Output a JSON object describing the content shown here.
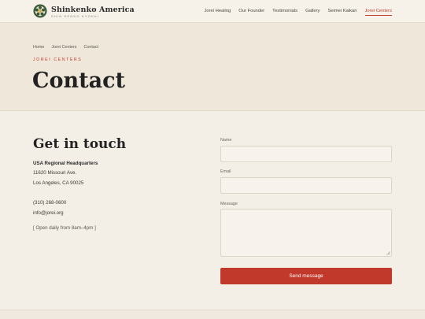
{
  "brand": {
    "name": "Shinkenko America",
    "subtitle": "SHIN KENKO KYOKAI",
    "logo_icon": "flower-emblem-icon",
    "logo_colors": {
      "outer": "#3b5a3a",
      "inner": "#d9b24a"
    }
  },
  "nav": {
    "items": [
      {
        "label": "Jorei Healing"
      },
      {
        "label": "Our Founder"
      },
      {
        "label": "Testimonials"
      },
      {
        "label": "Gallery"
      },
      {
        "label": "Seimei Kaikan"
      },
      {
        "label": "Jorei Centers",
        "active": true
      }
    ]
  },
  "breadcrumb": [
    "Home",
    "Jorei Centers",
    "Contact"
  ],
  "hero": {
    "eyebrow": "JOREI CENTERS",
    "title": "Contact"
  },
  "contact": {
    "heading": "Get in touch",
    "hq_name": "USA Regional Headquarters",
    "address_line1": "11620 Missouri Ave.",
    "address_line2": "Los Angeles, CA 90025",
    "phone": "(310) 268-0600",
    "email": "info@jorei.org",
    "hours": "[ Open daily from 8am–4pm ]"
  },
  "form": {
    "name_label": "Name",
    "name_value": "",
    "email_label": "Email",
    "email_value": "",
    "message_label": "Message",
    "message_value": "",
    "submit_label": "Send message"
  },
  "colors": {
    "accent": "#c0392b",
    "background": "#f4efe6",
    "hero_background": "#efe7da"
  }
}
